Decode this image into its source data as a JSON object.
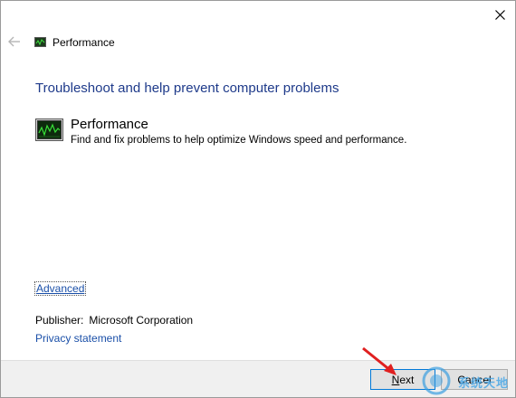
{
  "window": {
    "title": "Performance",
    "close_icon": "close-icon",
    "back_icon": "back-arrow-icon"
  },
  "heading": "Troubleshoot and help prevent computer problems",
  "troubleshooter": {
    "title": "Performance",
    "description": "Find and fix problems to help optimize Windows speed and performance.",
    "icon": "performance-monitor-icon"
  },
  "advanced_link": "Advanced",
  "publisher": {
    "label": "Publisher:",
    "value": "Microsoft Corporation"
  },
  "privacy_link": "Privacy statement",
  "buttons": {
    "next_prefix": "N",
    "next_rest": "ext",
    "cancel_label": "Cancel"
  },
  "watermark_text": "系统天地",
  "colors": {
    "heading": "#1e3a8a",
    "link": "#1a4fa8",
    "footer_bg": "#f0f0f0",
    "annotation_arrow": "#e02020",
    "next_focus_border": "#0078d7"
  }
}
